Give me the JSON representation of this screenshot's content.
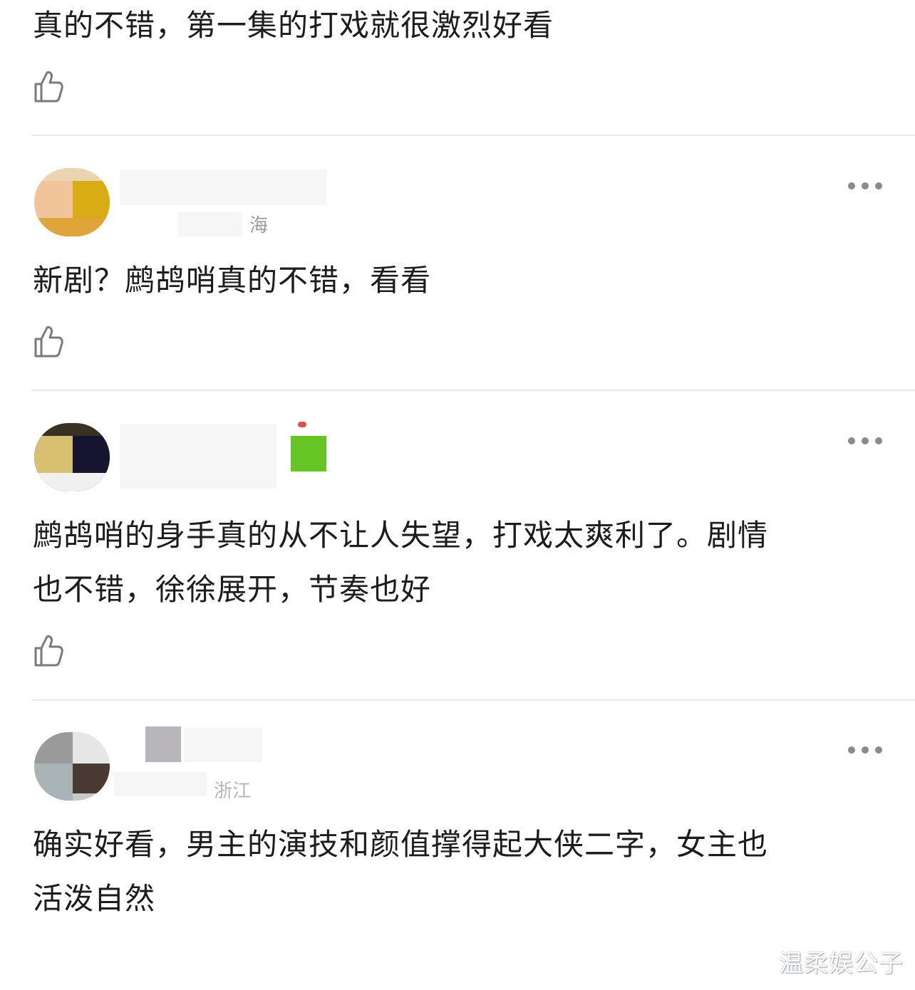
{
  "comments": [
    {
      "text_lines": [
        "真的不错，第一集的打戏就很激烈好看"
      ]
    },
    {
      "location": "海",
      "text_lines": [
        "新剧？鹧鸪哨真的不错，看看"
      ]
    },
    {
      "text_lines": [
        "鹧鸪哨的身手真的从不让人失望，打戏太爽利了。剧情",
        "也不错，徐徐展开，节奏也好"
      ]
    },
    {
      "location": "浙江",
      "text_lines": [
        "确实好看，男主的演技和颜值撑得起大侠二字，女主也",
        "活泼自然"
      ]
    }
  ],
  "icons": {
    "like": "thumbs-up-icon",
    "more": "more-dots-icon"
  },
  "colors": {
    "text": "#1c1c1c",
    "divider": "#e8e8e8",
    "more_dots": "#8a8a8a",
    "avatar1": [
      "#f2c49a",
      "#d9ac16"
    ],
    "avatar2": [
      "#d8c070",
      "#16142e"
    ],
    "avatar3": [
      "#9a9a9a",
      "#4a3a34"
    ],
    "badge_green": "#66c424"
  },
  "watermark": "温柔娱公子"
}
